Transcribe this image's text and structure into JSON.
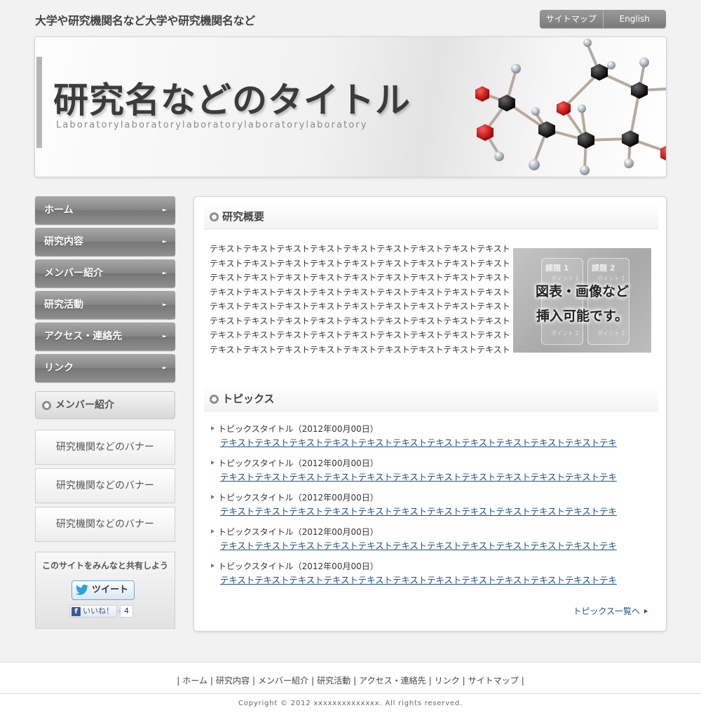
{
  "header": {
    "site_name": "大学や研究機関名など大学や研究機関名など",
    "sitemap_label": "サイトマップ",
    "english_label": "English"
  },
  "hero": {
    "title": "研究名などのタイトル",
    "subtitle": "Laboratorylaboratorylaboratorylaboratorylaboratory"
  },
  "nav": {
    "items": [
      {
        "label": "ホーム"
      },
      {
        "label": "研究内容"
      },
      {
        "label": "メンバー紹介"
      },
      {
        "label": "研究活動"
      },
      {
        "label": "アクセス・連絡先"
      },
      {
        "label": "リンク"
      }
    ]
  },
  "sidebar": {
    "member_heading": "メンバー紹介",
    "banners": [
      "研究機関などのバナー",
      "研究機関などのバナー",
      "研究機関などのバナー"
    ],
    "share": {
      "title": "このサイトをみんなと共有しよう",
      "tweet_label": "ツイート",
      "like_label": "いいね！",
      "like_count": "4"
    }
  },
  "overview": {
    "heading": "研究概要",
    "lines": [
      "テキストテキストテキストテキストテキストテキストテキストテキストテキストテキスト",
      "テキストテキストテキストテキストテキストテキストテキストテキストテキストテキスト",
      "テキストテキストテキストテキストテキストテキストテキストテキストテキストテキスト",
      "テキストテキストテキストテキストテキストテキストテキストテキストテキストテキスト",
      "テキストテキストテキストテキストテキストテキストテキストテキストテキストテキスト",
      "テキストテキストテキストテキストテキストテキストテキストテキストテキストテキスト",
      "テキストテキストテキストテキストテキストテキストテキストテキストテキストテキスト",
      "テキストテキストテキストテキストテキストテキストテキストテキストテキストテキスト"
    ],
    "figure": {
      "line1": "図表・画像など",
      "line2": "挿入可能です。",
      "task1": "課題 1",
      "task2": "課題 2",
      "point1": "ポイント 1",
      "point2": "ポイント 2"
    }
  },
  "topics": {
    "heading": "トピックス",
    "items": [
      {
        "title": "トピックスタイトル（2012年00月00日）",
        "link": "テキストテキストテキストテキストテキストテキストテキストテキストテキストテキストテキストテキ"
      },
      {
        "title": "トピックスタイトル（2012年00月00日）",
        "link": "テキストテキストテキストテキストテキストテキストテキストテキストテキストテキストテキストテキ"
      },
      {
        "title": "トピックスタイトル（2012年00月00日）",
        "link": "テキストテキストテキストテキストテキストテキストテキストテキストテキストテキストテキストテキ"
      },
      {
        "title": "トピックスタイトル（2012年00月00日）",
        "link": "テキストテキストテキストテキストテキストテキストテキストテキストテキストテキストテキストテキ"
      },
      {
        "title": "トピックスタイトル（2012年00月00日）",
        "link": "テキストテキストテキストテキストテキストテキストテキストテキストテキストテキストテキストテキ"
      }
    ],
    "more_label": "トピックス一覧へ"
  },
  "footer": {
    "links": [
      "ホーム",
      "研究内容",
      "メンバー紹介",
      "研究活動",
      "アクセス・連絡先",
      "リンク",
      "サイトマップ"
    ],
    "copyright": "Copyright © 2012 xxxxxxxxxxxxxx. All rights reserved."
  }
}
